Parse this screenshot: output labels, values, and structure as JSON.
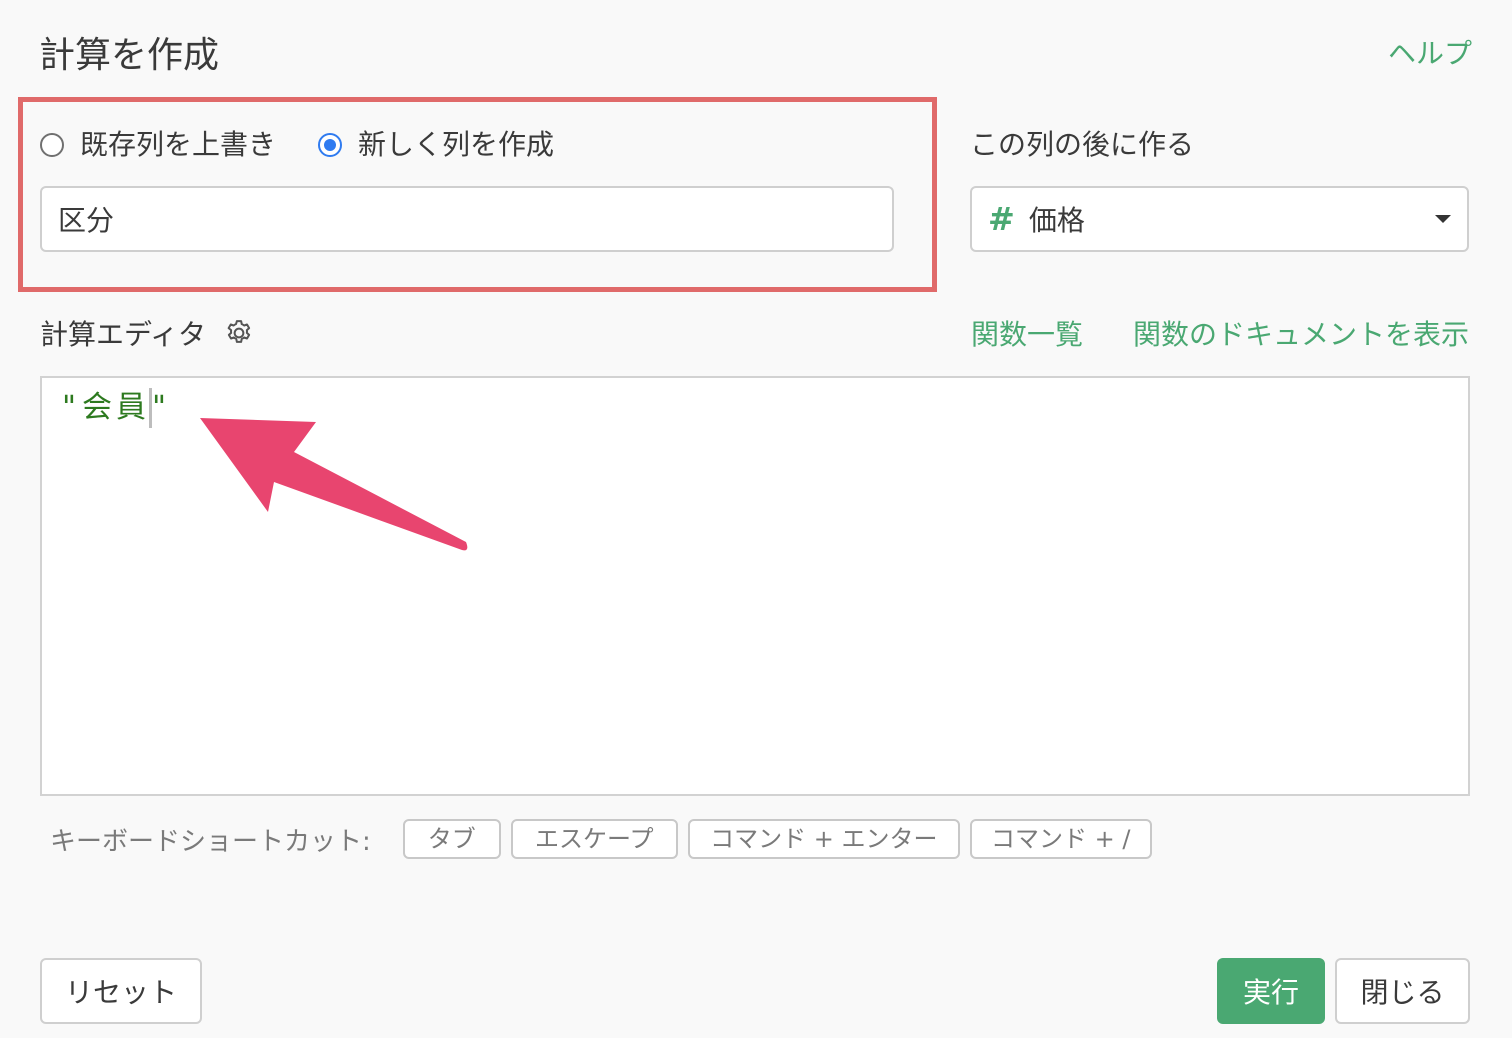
{
  "dialog": {
    "title": "計算を作成",
    "help_label": "ヘルプ"
  },
  "mode": {
    "options": [
      {
        "label": "既存列を上書き",
        "selected": false
      },
      {
        "label": "新しく列を作成",
        "selected": true
      }
    ]
  },
  "column_name": {
    "value": "区分"
  },
  "position": {
    "label": "この列の後に作る",
    "selected_column": "価格",
    "column_type_icon": "number-hash-icon"
  },
  "editor": {
    "label": "計算エディタ",
    "settings_icon": "gear-icon",
    "function_list_label": "関数一覧",
    "function_docs_label": "関数のドキュメントを表示",
    "code": "\"会員\""
  },
  "shortcuts": {
    "label": "キーボードショートカット:",
    "keys": [
      "タブ",
      "エスケープ",
      "コマンド + エンター",
      "コマンド + /"
    ]
  },
  "footer": {
    "reset_label": "リセット",
    "run_label": "実行",
    "close_label": "閉じる"
  },
  "colors": {
    "accent_green": "#4aa872",
    "highlight_red": "#e06a6a",
    "radio_blue": "#2f7bf0",
    "annotation_arrow": "#e8456f",
    "code_green": "#2d7a1f"
  }
}
